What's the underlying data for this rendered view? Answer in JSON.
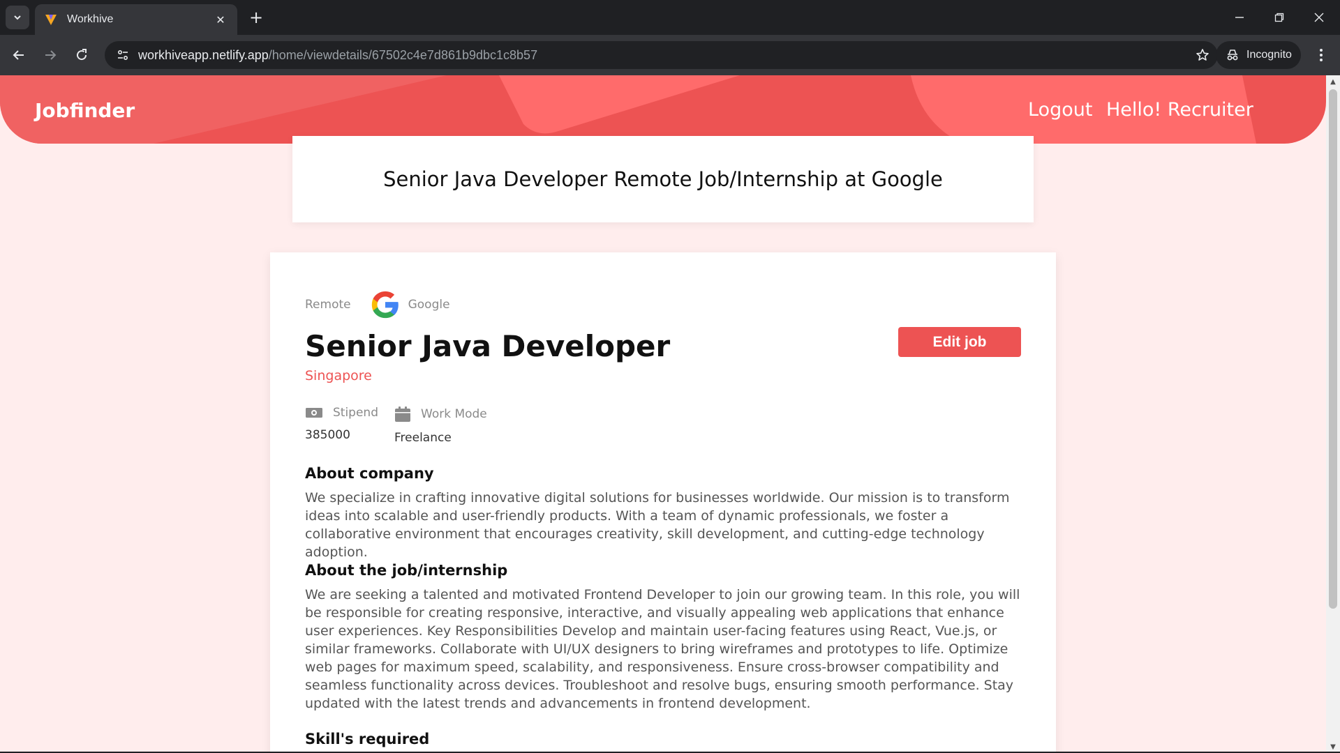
{
  "browser": {
    "tab_title": "Workhive",
    "url_host": "workhiveapp.netlify.app",
    "url_path": "/home/viewdetails/67502c4e7d861b9dbc1c8b57",
    "incognito_label": "Incognito"
  },
  "header": {
    "brand": "Jobfinder",
    "logout": "Logout",
    "greeting": "Hello! Recruiter",
    "accent_color": "#ed5353"
  },
  "page_title": "Senior Java Developer Remote Job/Internship at Google",
  "job": {
    "type": "Remote",
    "company": "Google",
    "title": "Senior Java Developer",
    "location": "Singapore",
    "edit_label": "Edit job",
    "stipend_label": "Stipend",
    "stipend_value": "385000",
    "work_mode_label": "Work Mode",
    "work_mode_value": "Freelance",
    "about_company_title": "About company",
    "about_company": "We specialize in crafting innovative digital solutions for businesses worldwide. Our mission is to transform ideas into scalable and user-friendly products. With a team of dynamic professionals, we foster a collaborative environment that encourages creativity, skill development, and cutting-edge technology adoption.",
    "about_job_title": "About the job/internship",
    "about_job": "We are seeking a talented and motivated Frontend Developer to join our growing team. In this role, you will be responsible for creating responsive, interactive, and visually appealing web applications that enhance user experiences. Key Responsibilities Develop and maintain user-facing features using React, Vue.js, or similar frameworks. Collaborate with UI/UX designers to bring wireframes and prototypes to life. Optimize web pages for maximum speed, scalability, and responsiveness. Ensure cross-browser compatibility and seamless functionality across devices. Troubleshoot and resolve bugs, ensuring smooth performance. Stay updated with the latest trends and advancements in frontend development.",
    "skills_title": "Skill's required"
  }
}
